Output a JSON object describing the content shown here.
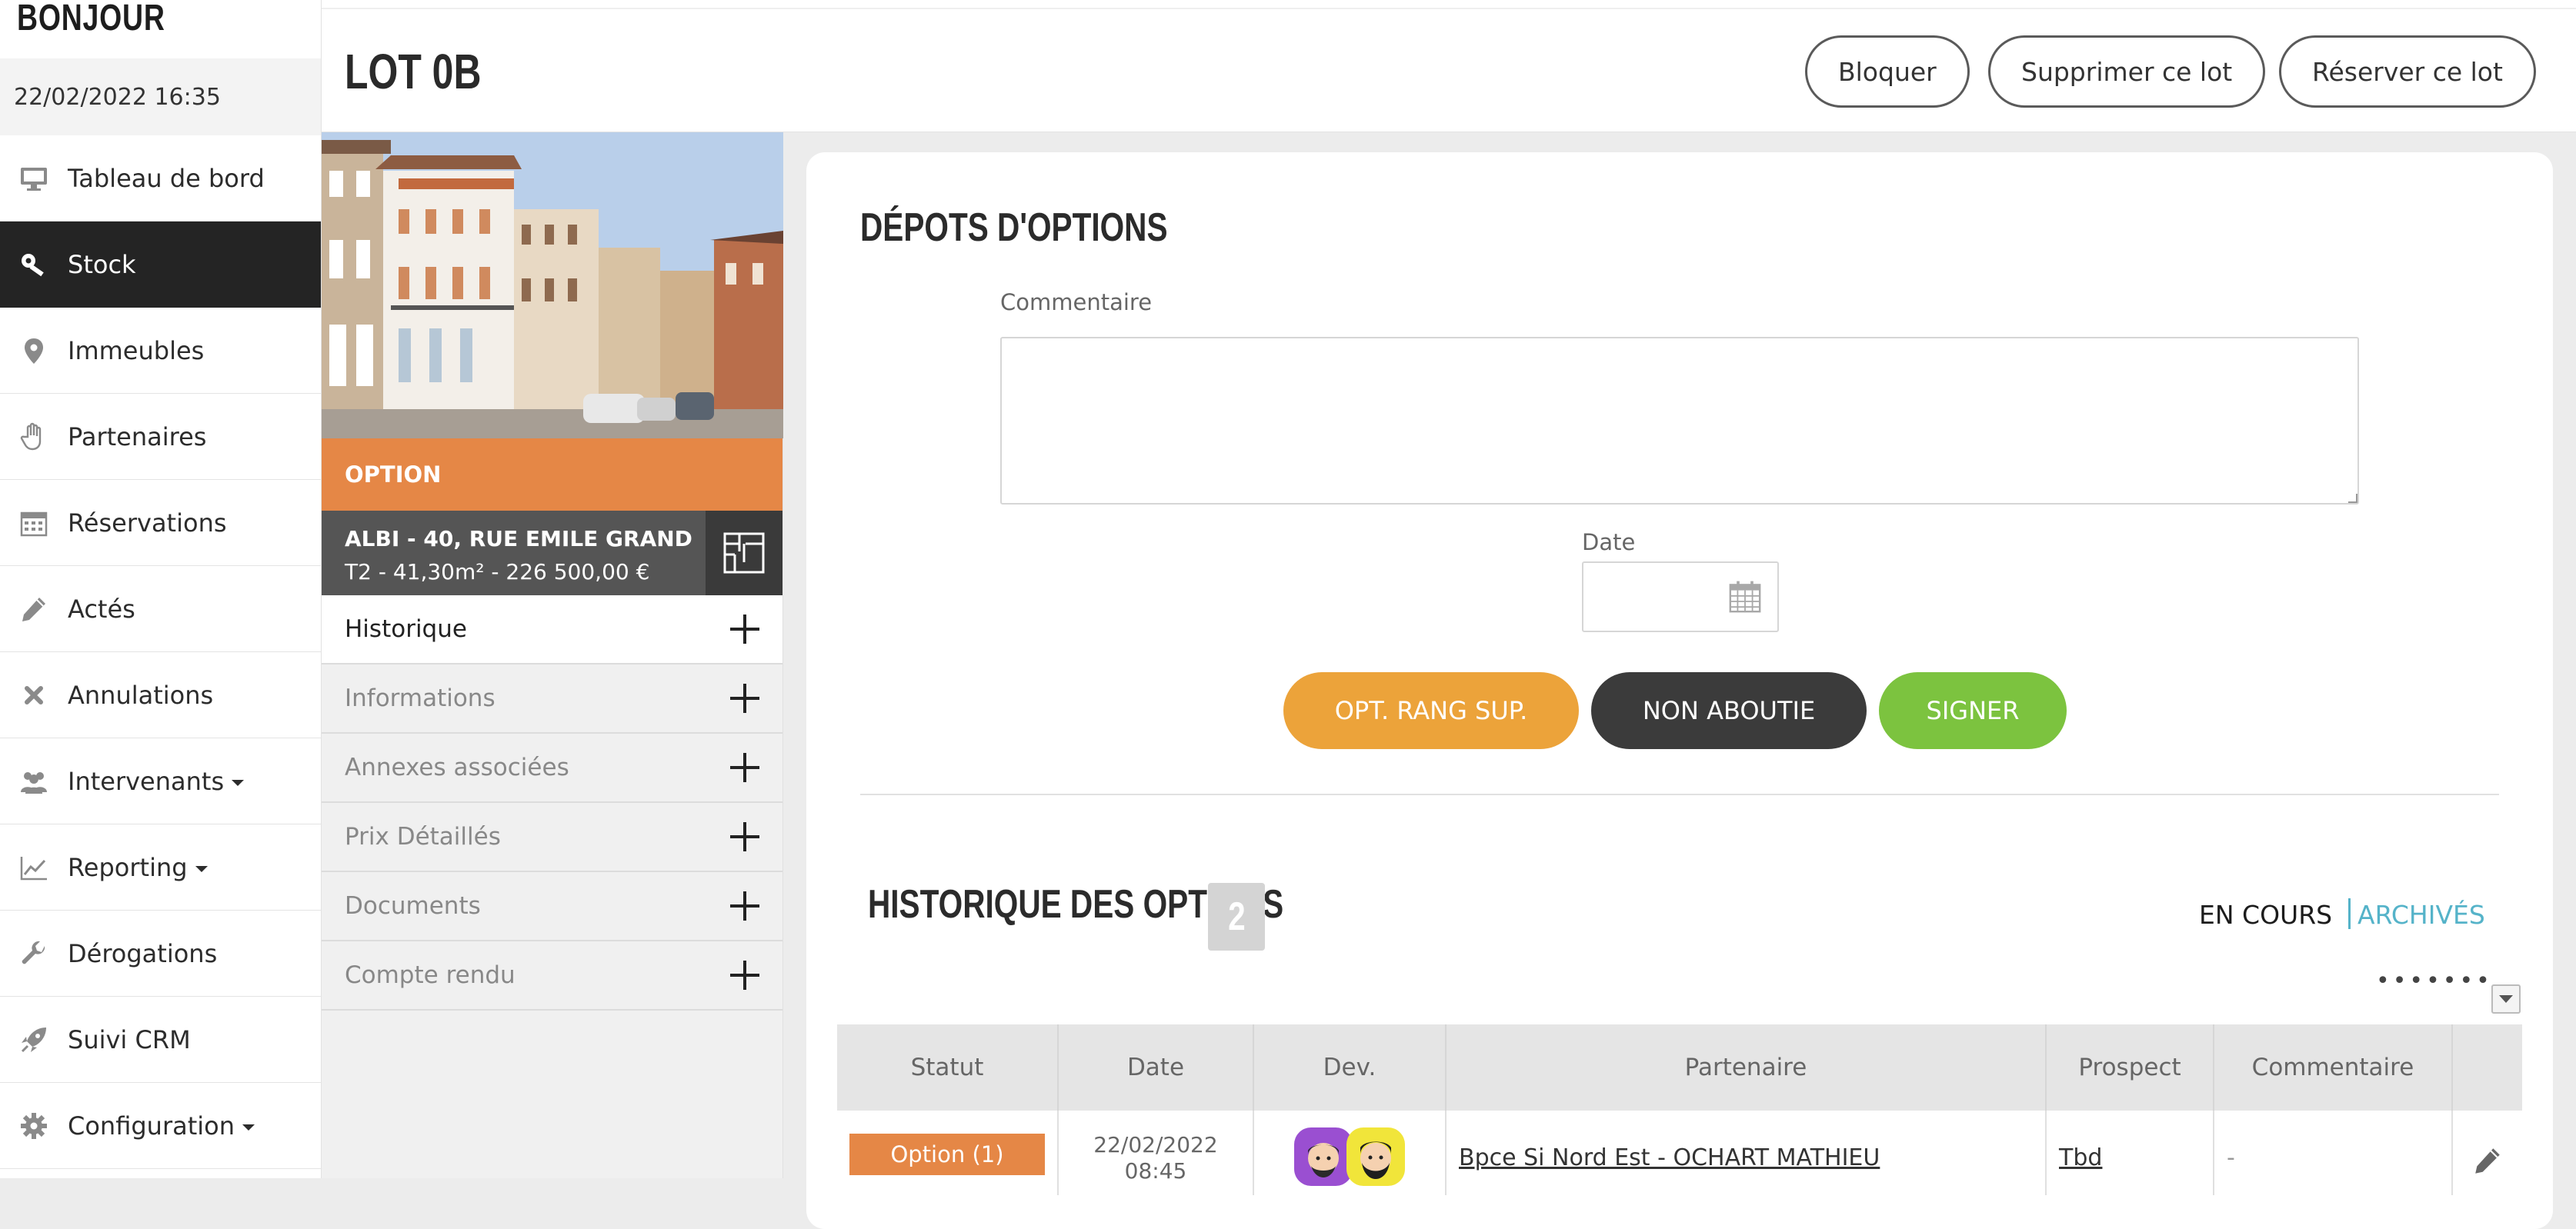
{
  "sidebar": {
    "brand": "BONJOUR",
    "datetime": "22/02/2022 16:35",
    "items": [
      {
        "label": "Tableau de bord",
        "icon": "monitor-icon"
      },
      {
        "label": "Stock",
        "icon": "key-icon",
        "active": true
      },
      {
        "label": "Immeubles",
        "icon": "map-pin-icon"
      },
      {
        "label": "Partenaires",
        "icon": "hand-icon"
      },
      {
        "label": "Réservations",
        "icon": "calendar-icon"
      },
      {
        "label": "Actés",
        "icon": "pencil-icon"
      },
      {
        "label": "Annulations",
        "icon": "close-icon"
      },
      {
        "label": "Intervenants",
        "icon": "users-icon",
        "dropdown": true
      },
      {
        "label": "Reporting",
        "icon": "chart-line-icon",
        "dropdown": true
      },
      {
        "label": "Dérogations",
        "icon": "wrench-icon"
      },
      {
        "label": "Suivi CRM",
        "icon": "rocket-icon"
      },
      {
        "label": "Configuration",
        "icon": "gear-icon",
        "dropdown": true
      }
    ]
  },
  "header": {
    "title": "LOT 0B",
    "buttons": {
      "block": "Bloquer",
      "delete": "Supprimer ce lot",
      "reserve": "Réserver ce lot"
    }
  },
  "lot": {
    "status": "OPTION",
    "address": "ALBI - 40, RUE EMILE GRAND",
    "details": "T2 - 41,30m² - 226 500,00 €",
    "accordion": [
      "Historique",
      "Informations",
      "Annexes associées",
      "Prix Détaillés",
      "Documents",
      "Compte rendu"
    ]
  },
  "options_deposit": {
    "title": "DÉPOTS D'OPTIONS",
    "comment_label": "Commentaire",
    "comment_value": "",
    "date_label": "Date",
    "date_value": "",
    "actions": {
      "rank_up": "OPT. RANG SUP.",
      "not_completed": "NON ABOUTIE",
      "sign": "SIGNER"
    },
    "colors": {
      "rank_up": "#eca33a",
      "not_completed": "#3b3b3b",
      "sign": "#7cc33f"
    }
  },
  "history": {
    "title": "HISTORIQUE DES OPTIONS",
    "count": "2",
    "filter_current": "EN COURS",
    "filter_archived": "ARCHIVÉS",
    "more_dots": "•••••••",
    "columns": [
      "Statut",
      "Date",
      "Dev.",
      "Partenaire",
      "Prospect",
      "Commentaire"
    ],
    "rows": [
      {
        "status": "Option (1)",
        "date_line1": "22/02/2022",
        "date_line2": "08:45",
        "partner": "Bpce Si Nord Est - OCHART MATHIEU",
        "prospect": "Tbd",
        "comment": "-"
      }
    ]
  },
  "colors": {
    "accent_orange": "#e58746",
    "link_blue": "#55b3c9",
    "dark_nav": "#242424"
  }
}
